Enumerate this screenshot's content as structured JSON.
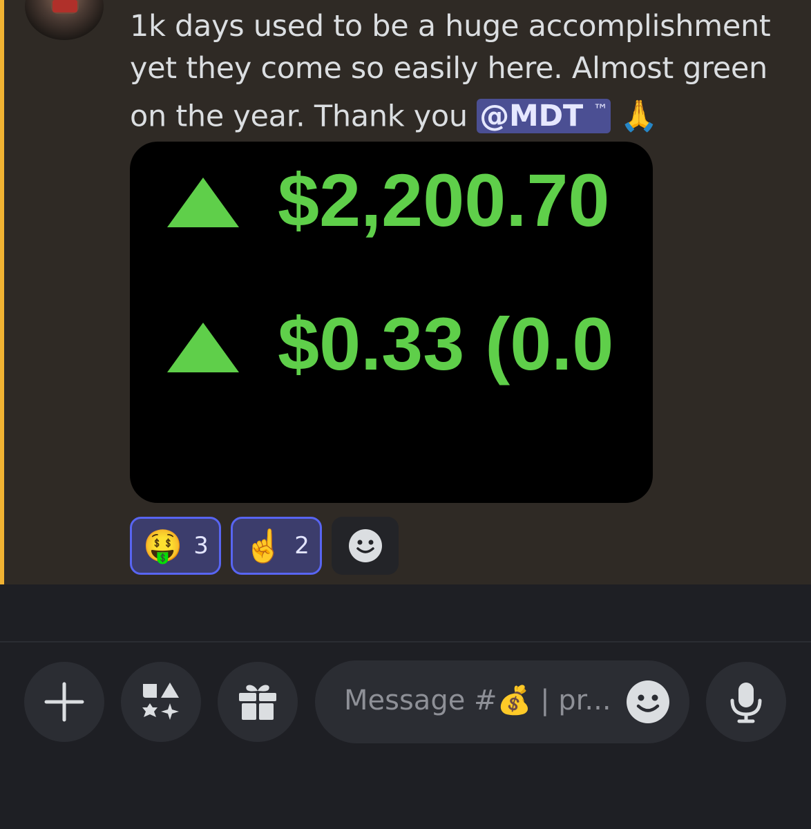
{
  "message": {
    "text_before_mention": "1k days used to be a huge accomplishment yet they come so easily here.  Almost green on the year.  Thank you ",
    "mention": "@MDT",
    "mention_suffix": "™",
    "trailing_emoji": "🙏",
    "attachment": {
      "line1_amount": "$2,200.70",
      "line2_amount": "$0.33 (0.0",
      "arrow_symbol": "▲",
      "text_color": "#5fcf4a",
      "background": "#000000"
    }
  },
  "reactions": [
    {
      "emoji": "🤑",
      "count": "3"
    },
    {
      "emoji": "☝️",
      "count": "2"
    }
  ],
  "composer": {
    "placeholder": "Message #💰 | pr...",
    "buttons": [
      {
        "icon": "plus-icon"
      },
      {
        "icon": "apps-icon"
      },
      {
        "icon": "gift-icon"
      },
      {
        "icon": "microphone-icon"
      }
    ]
  },
  "colors": {
    "highlight_bar": "#f0b232",
    "mention_bg": "#4b4f93",
    "reaction_border": "#5865f2",
    "message_bg": "#2f2a25",
    "composer_bg": "#1e1f24"
  }
}
